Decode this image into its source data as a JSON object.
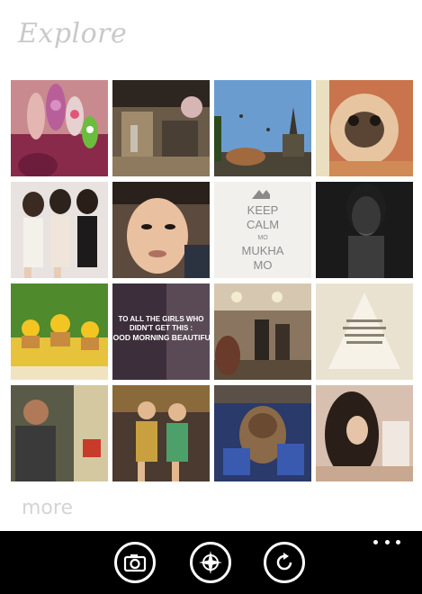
{
  "header": {
    "title": "Explore"
  },
  "tiles": {
    "keep_calm": {
      "line1": "KEEP",
      "line2": "CALM",
      "line3": "MO",
      "line4": "MUKHA",
      "line5": "MO"
    },
    "girls_quote": {
      "line1": "TO ALL THE GIRLS WHO",
      "line2": "DIDN'T GET THIS :",
      "line3": "GOOD MORNING BEAUTIFUL"
    }
  },
  "footer": {
    "more_label": "more"
  },
  "appbar": {
    "buttons": [
      "camera",
      "explore-compass",
      "refresh"
    ]
  }
}
